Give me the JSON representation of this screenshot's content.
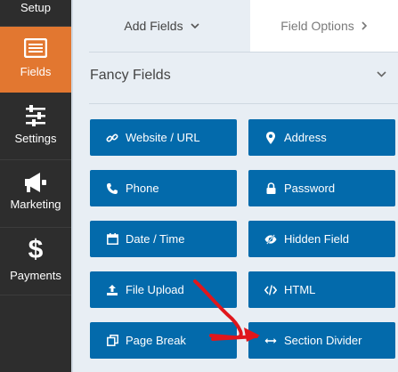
{
  "sidebar": {
    "items": [
      {
        "label": "Setup",
        "icon": "setup-icon"
      },
      {
        "label": "Fields",
        "icon": "fields-list-icon",
        "active": true
      },
      {
        "label": "Settings",
        "icon": "sliders-icon"
      },
      {
        "label": "Marketing",
        "icon": "megaphone-icon"
      },
      {
        "label": "Payments",
        "icon": "dollar-icon"
      }
    ]
  },
  "tabs": {
    "add_fields": "Add Fields",
    "field_options": "Field Options"
  },
  "section": {
    "title": "Fancy Fields"
  },
  "fields": [
    {
      "label": "Website / URL",
      "icon": "link-icon"
    },
    {
      "label": "Address",
      "icon": "map-pin-icon"
    },
    {
      "label": "Phone",
      "icon": "phone-icon"
    },
    {
      "label": "Password",
      "icon": "lock-icon"
    },
    {
      "label": "Date / Time",
      "icon": "calendar-icon"
    },
    {
      "label": "Hidden Field",
      "icon": "eye-slash-icon"
    },
    {
      "label": "File Upload",
      "icon": "upload-icon"
    },
    {
      "label": "HTML",
      "icon": "code-icon"
    },
    {
      "label": "Page Break",
      "icon": "copy-icon"
    },
    {
      "label": "Section Divider",
      "icon": "arrows-h-icon"
    }
  ],
  "colors": {
    "sidebar_bg": "#2d2d2d",
    "active_orange": "#e27730",
    "button_blue": "#036aab",
    "panel_bg": "#e8eef4",
    "annotation_red": "#e0161c"
  }
}
